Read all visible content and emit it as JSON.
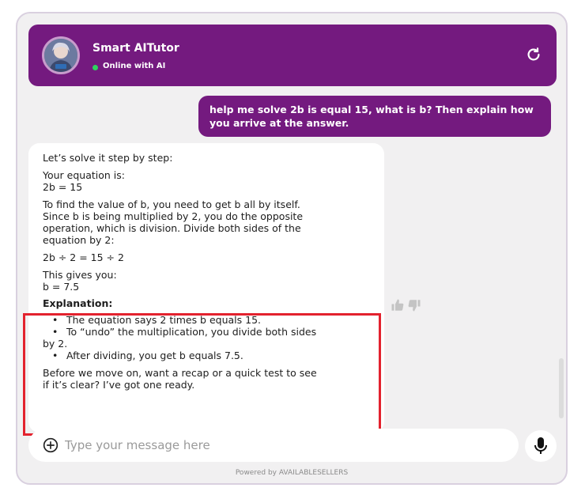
{
  "header": {
    "title": "Smart AITutor",
    "status": "Online with AI",
    "status_color": "#2fd35e",
    "accent_color": "#741a7f",
    "avatar_icon": "tutor-avatar-icon",
    "refresh_icon": "refresh-icon"
  },
  "messages": {
    "user": "help me solve 2b is equal 15, what is b? Then explain how you arrive at the answer.",
    "bot": {
      "intro": "Let’s solve it step by step:",
      "eq_label": "Your equation is:",
      "eq": "2b = 15",
      "para_lines": [
        "To find the value of b, you need to get b all by itself.",
        "Since b is being multiplied by 2, you do the opposite",
        "operation, which is division. Divide both sides of the",
        "equation by 2:"
      ],
      "division": "2b ÷ 2 = 15 ÷ 2",
      "gives": "This gives you:",
      "result": "b = 7.5",
      "explanation_heading": "Explanation:",
      "bullets": {
        "b1": "The equation says 2 times b equals 15.",
        "b2_line1": "To “undo” the multiplication, you divide both sides",
        "b2_line2": "by 2.",
        "b3": "After dividing, you get b equals 7.5."
      },
      "closing_lines": [
        "Before we move on, want a recap or a quick test to see",
        "if it’s clear? I’ve got one ready."
      ]
    }
  },
  "feedback": {
    "up_icon": "thumbs-up-icon",
    "down_icon": "thumbs-down-icon"
  },
  "input": {
    "placeholder": "Type your message here",
    "value": ""
  },
  "footer": {
    "powered_by": "Powered by AVAILABLESELLERS"
  },
  "highlight_color": "#e3222e"
}
